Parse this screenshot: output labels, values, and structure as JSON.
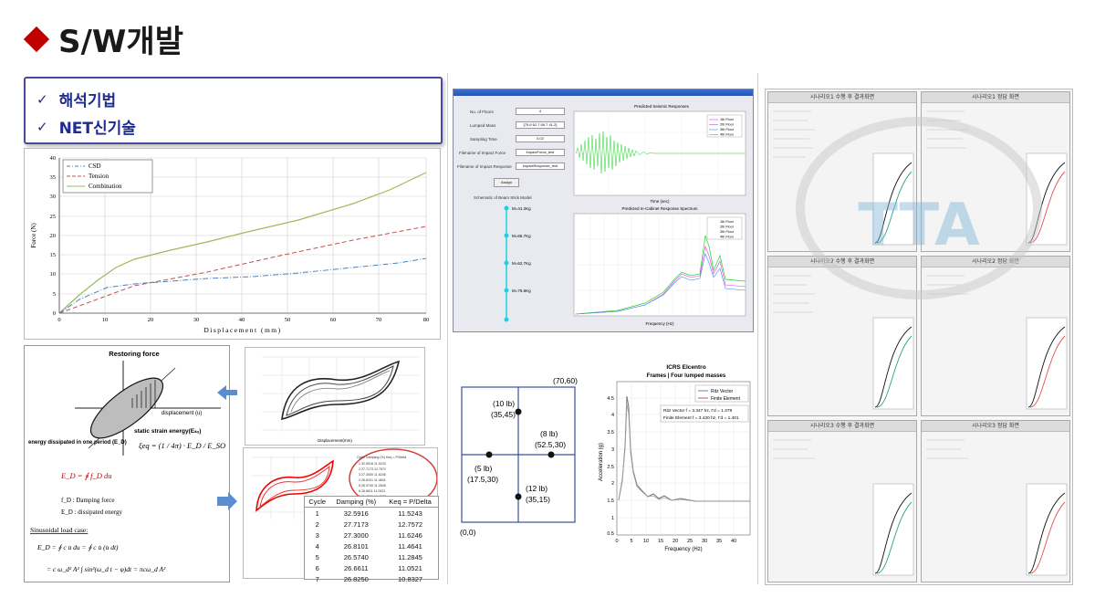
{
  "title": "S/W개발",
  "techniques": [
    "해석기법",
    "NET신기술"
  ],
  "force_chart": {
    "legend": [
      "CSD",
      "Tension",
      "Combination"
    ],
    "xlabel": "Displacement (mm)",
    "ylabel": "Force (N)",
    "xticks": [
      "0",
      "10",
      "20",
      "30",
      "40",
      "50",
      "60",
      "70",
      "80"
    ],
    "yticks": [
      "0",
      "5",
      "10",
      "15",
      "20",
      "25",
      "30",
      "35",
      "40"
    ]
  },
  "mechanics": {
    "restoring_force": "Restoring force",
    "displacement": "displacement (u)",
    "strain_energy": "static strain energy(Eₛₒ)",
    "energy_dissipated": "energy dissipated in one period (E_D)",
    "xi_formula": "ξeq = (1 / 4π) · E_D / E_SO",
    "ed_formula": "E_D = ∮ f_D du",
    "fd_desc": "f_D : Damping force",
    "ed_desc": "E_D : dissipated energy",
    "sinusoidal": "Sinusoidal load case:",
    "eq1": "E_D = ∮ c u̇ du = ∮ c u̇ (u̇ dt)",
    "eq2": "= c ω_d² A² ∫ sin²(ω_d t − φ)dt = πcω_d A²"
  },
  "cycle_table": {
    "headers": [
      "Cycle",
      "Damping (%)",
      "Keq = P/Delta"
    ],
    "rows": [
      [
        "1",
        "32.5916",
        "11.5243"
      ],
      [
        "2",
        "27.7173",
        "12.7572"
      ],
      [
        "3",
        "27.3000",
        "11.6246"
      ],
      [
        "4",
        "26.8101",
        "11.4641"
      ],
      [
        "5",
        "26.5740",
        "11.2845"
      ],
      [
        "6",
        "26.6611",
        "11.0521"
      ],
      [
        "7",
        "26.8250",
        "10.8327"
      ]
    ]
  },
  "software": {
    "labels": [
      "No. of Floors",
      "Lumped Mass",
      "Sampling Time",
      "Filename of Impact Force",
      "Filename of Impact Response"
    ],
    "values": [
      "4",
      "[75.6 62.7 66.7 41.2]",
      "0.02",
      "impactForce_test",
      "impactResponse_test"
    ],
    "assign": "Assign",
    "model_title": "Schematic of Beam Stick Model",
    "masses": [
      "M=41.2Kg",
      "M=66.7Kg",
      "M=62.7Kg",
      "M=75.6Kg"
    ],
    "plot1_title": "Predicted Seismic Responses",
    "plot2_title": "Predicted In-Cabinet Response Spectrum",
    "floors": [
      "1th Floor",
      "2th Floor",
      "3th Floor",
      "4th Floor"
    ],
    "plot1_xlabel": "Time (sec)",
    "plot2_xlabel": "Frequency (Hz)"
  },
  "mass_diagram": {
    "corner_top": "(70,60)",
    "corner_origin": "(0,0)",
    "m1": [
      "(10 lb)",
      "(35,45)"
    ],
    "m2": [
      "(8 lb)",
      "(52.5,30)"
    ],
    "m3": [
      "(5 lb)",
      "(17.5,30)"
    ],
    "m4": [
      "(12 lb)",
      "(35,15)"
    ]
  },
  "icrs": {
    "title1": "ICRS Elcentro",
    "title2": "Frames | Four lumped masses",
    "legend": [
      "Ritz Vector",
      "Finite Element"
    ],
    "note1": "Ritz Vector    f = 3.347 hz, Γd = 1.379",
    "note2": "Finite Element f = 3.420 hz, Γd = 1.401",
    "ylabel": "Acceleration (g)",
    "xlabel": "Frequency (Hz)",
    "yticks": [
      "4.5",
      "4",
      "3.5",
      "3",
      "2.5",
      "2",
      "1.5",
      "1",
      "0.5"
    ],
    "xticks": [
      "0",
      "5",
      "10",
      "15",
      "20",
      "25",
      "30",
      "35",
      "40"
    ]
  },
  "reports": [
    "시나리오1 수행 후 결과화면",
    "시나리오1 정답 화면",
    "시나리오2 수행 후 결과화면",
    "시나리오2 정답 화면",
    "시나리오3 수행 후 결과화면",
    "시나리오3 정답 화면"
  ],
  "watermark": "TTA"
}
